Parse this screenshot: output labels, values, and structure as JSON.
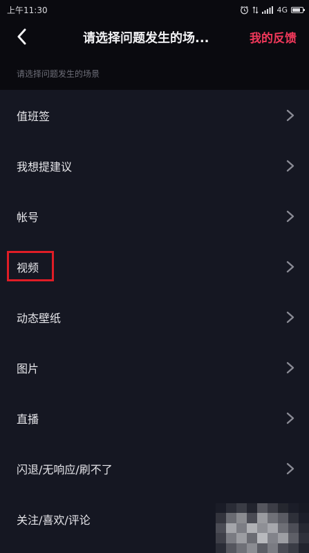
{
  "status_bar": {
    "time": "上午11:30",
    "network": "4G",
    "icons": [
      "alarm-icon",
      "data-arrows-icon",
      "signal-icon",
      "battery-icon"
    ]
  },
  "nav": {
    "back_icon": "chevron-left-icon",
    "title": "请选择问题发生的场...",
    "action": "我的反馈"
  },
  "section_header": "请选择问题发生的场景",
  "list": {
    "items": [
      {
        "label": "值班签"
      },
      {
        "label": "我想提建议"
      },
      {
        "label": "帐号"
      },
      {
        "label": "视频"
      },
      {
        "label": "动态壁纸"
      },
      {
        "label": "图片"
      },
      {
        "label": "直播"
      },
      {
        "label": "闪退/无响应/刷不了"
      },
      {
        "label": "关注/喜欢/评论"
      }
    ],
    "chevron_icon": "chevron-right-icon"
  },
  "colors": {
    "background": "#151722",
    "header_background": "#0a0a0f",
    "accent": "#f0385a",
    "highlight": "#e01d26"
  }
}
